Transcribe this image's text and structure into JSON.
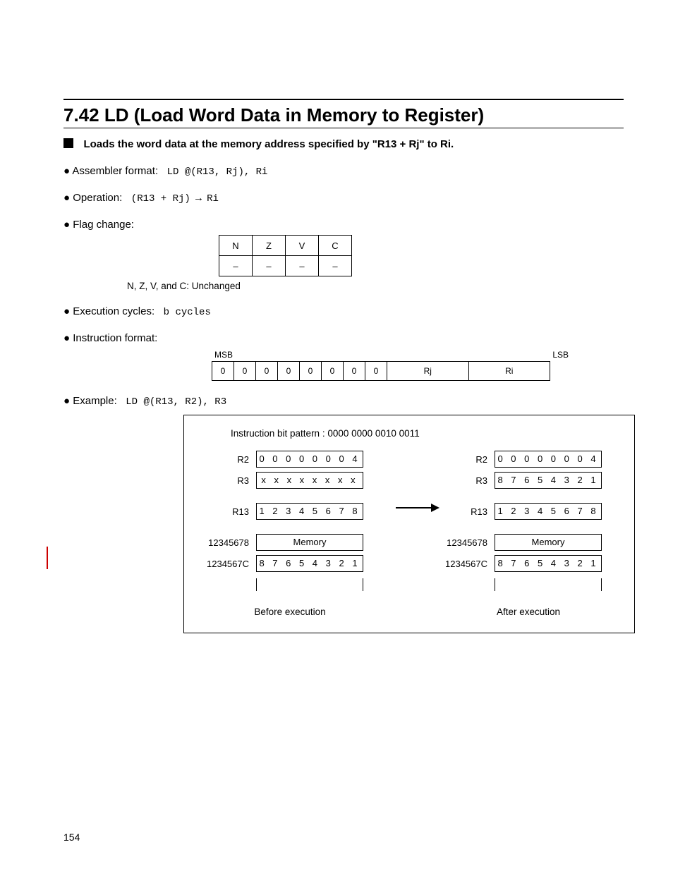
{
  "header": {
    "mnemonic": "7.42  LD (Load Word Data in Memory to Register)",
    "summary": "Loads the word data at the memory address specified by \"R13 + Rj\" to Ri."
  },
  "assembler": {
    "label": "Assembler format:",
    "value": "LD @(R13, Rj), Ri"
  },
  "operation": {
    "label": "Operation:",
    "lhs": "(R13 + Rj)",
    "arrow": "→",
    "rhs": "Ri"
  },
  "flags": {
    "label": "Flag change:",
    "cols": [
      "N",
      "Z",
      "V",
      "C"
    ],
    "vals": [
      "–",
      "–",
      "–",
      "–"
    ],
    "note": "N, Z, V, and C: Unchanged"
  },
  "cycles": {
    "label": "Execution cycles:",
    "value": "b cycles"
  },
  "fmt": {
    "label": "Instruction format:",
    "msb": "MSB",
    "lsb": "LSB",
    "bits": [
      "0",
      "0",
      "0",
      "0",
      "0",
      "0",
      "0",
      "0"
    ],
    "fields": [
      "Rj",
      "Ri"
    ]
  },
  "example": {
    "label": "Example:",
    "asm": "LD @(R13, R2), R3",
    "caption": "Instruction bit pattern : 0000 0000 0010 0011",
    "before_title": "Before execution",
    "after_title": "After execution",
    "before": {
      "R2": "0 0 0 0  0 0 0 4",
      "R3": "x x x x  x x x x",
      "R13": "1 2 3 4  5 6 7 8",
      "addr1": "12345678",
      "mem1": "Memory",
      "addr2": "1234567C",
      "mem2": "8 7 6 5  4 3 2 1"
    },
    "after": {
      "R2": "0 0 0 0  0 0 0 4",
      "R3": "8 7 6 5  4 3 2 1",
      "R13": "1 2 3 4  5 6 7 8",
      "addr1": "12345678",
      "mem1": "Memory",
      "addr2": "1234567C",
      "mem2": "8 7 6 5  4 3 2 1"
    }
  },
  "page_number": "154"
}
